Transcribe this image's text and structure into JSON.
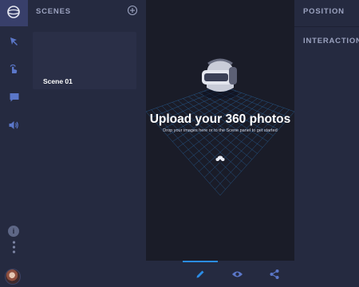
{
  "app": {
    "logo_icon": "sphere-logo-icon",
    "accent_color": "#2b8ce6"
  },
  "rail": {
    "tools": [
      {
        "name": "select-tool",
        "icon": "cursor-arrow-icon"
      },
      {
        "name": "hotspot-tool",
        "icon": "tap-hand-icon"
      },
      {
        "name": "comment-tool",
        "icon": "chat-bubble-icon"
      },
      {
        "name": "audio-tool",
        "icon": "speaker-icon"
      }
    ],
    "info_label": "i",
    "more_icon": "vertical-dots-icon"
  },
  "scenes_panel": {
    "title": "SCENES",
    "add_icon": "plus-circle-icon",
    "items": [
      {
        "label": "Scene 01"
      }
    ]
  },
  "canvas": {
    "headline": "Upload your 360 photos",
    "subtitle": "Drop your images here or to the Scene panel to get started",
    "upload_icon": "cloud-upload-icon",
    "illustration": "vr-headset-on-grid-illustration"
  },
  "properties": {
    "position_label": "POSITION",
    "interaction_label": "INTERACTION"
  },
  "bottom_tabs": [
    {
      "name": "edit",
      "icon": "pencil-icon",
      "active": true
    },
    {
      "name": "preview",
      "icon": "eye-icon",
      "active": false
    },
    {
      "name": "share",
      "icon": "share-icon",
      "active": false
    }
  ]
}
